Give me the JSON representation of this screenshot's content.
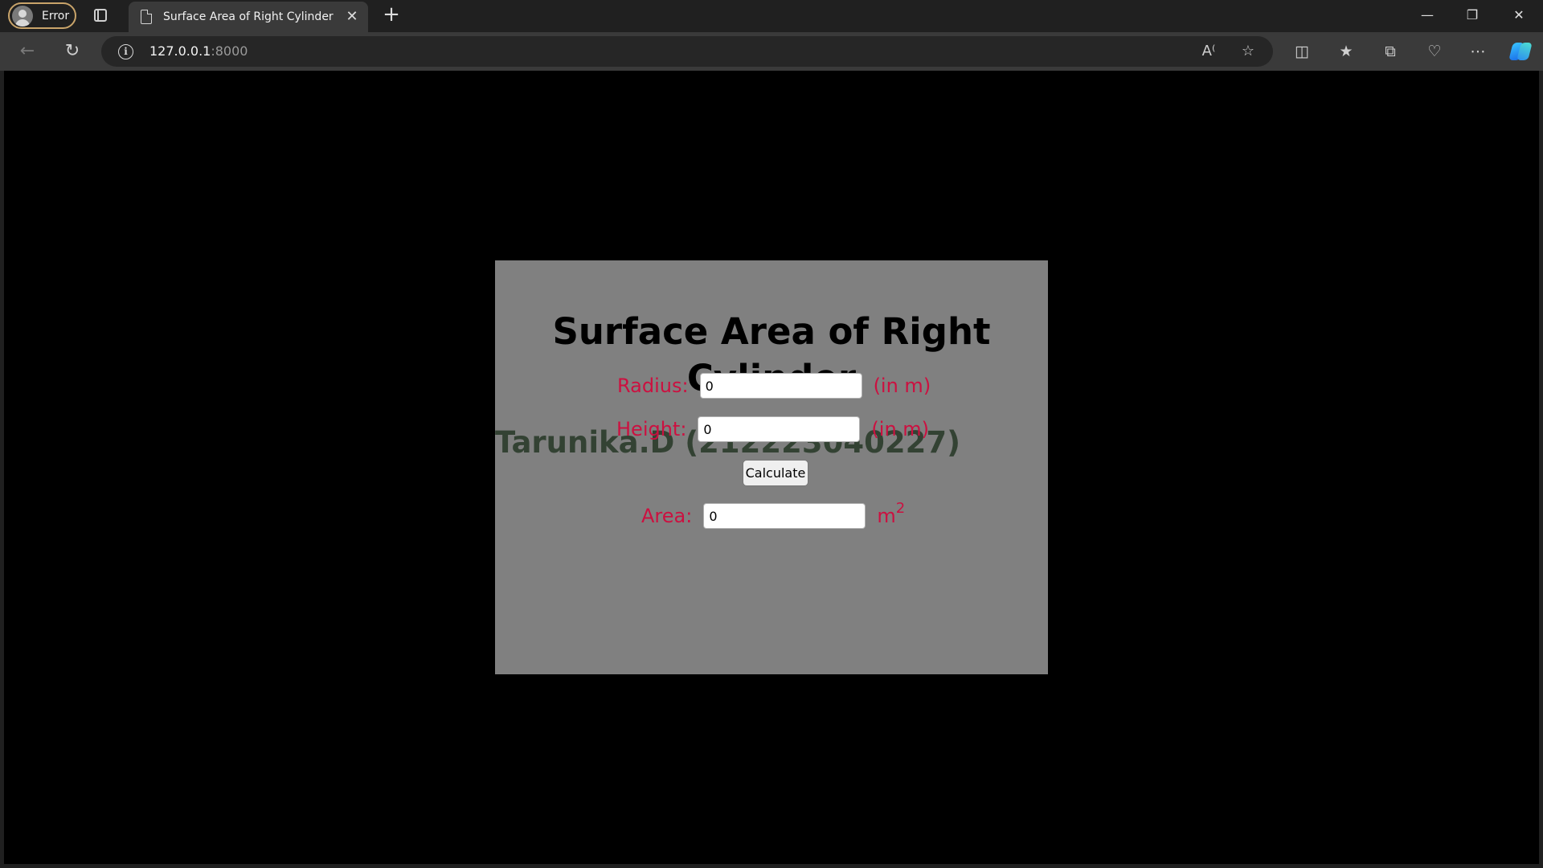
{
  "browser": {
    "profile_label": "Error",
    "tab_title": "Surface Area of Right Cylinder",
    "tab_close": "✕",
    "new_tab": "+",
    "url_host": "127.0.0.1",
    "url_port": ":8000",
    "window_controls": {
      "minimize": "—",
      "restore": "❐",
      "close": "✕"
    }
  },
  "page": {
    "heading": "Surface Area of Right Cylinder",
    "author": "Tarunika.D (212223040227)",
    "radius": {
      "label": "Radius:",
      "value": "0",
      "unit": "(in m)"
    },
    "height": {
      "label": "Height:",
      "value": "0",
      "unit": "(in m)"
    },
    "calculate_label": "Calculate",
    "area": {
      "label": "Area:",
      "value": "0",
      "unit_base": "m",
      "unit_exponent": "2"
    }
  },
  "colors": {
    "card_background": "#808080",
    "page_background": "#000000",
    "label_color": "#cc1040",
    "author_color": "#334233",
    "heading_color": "#000000"
  }
}
